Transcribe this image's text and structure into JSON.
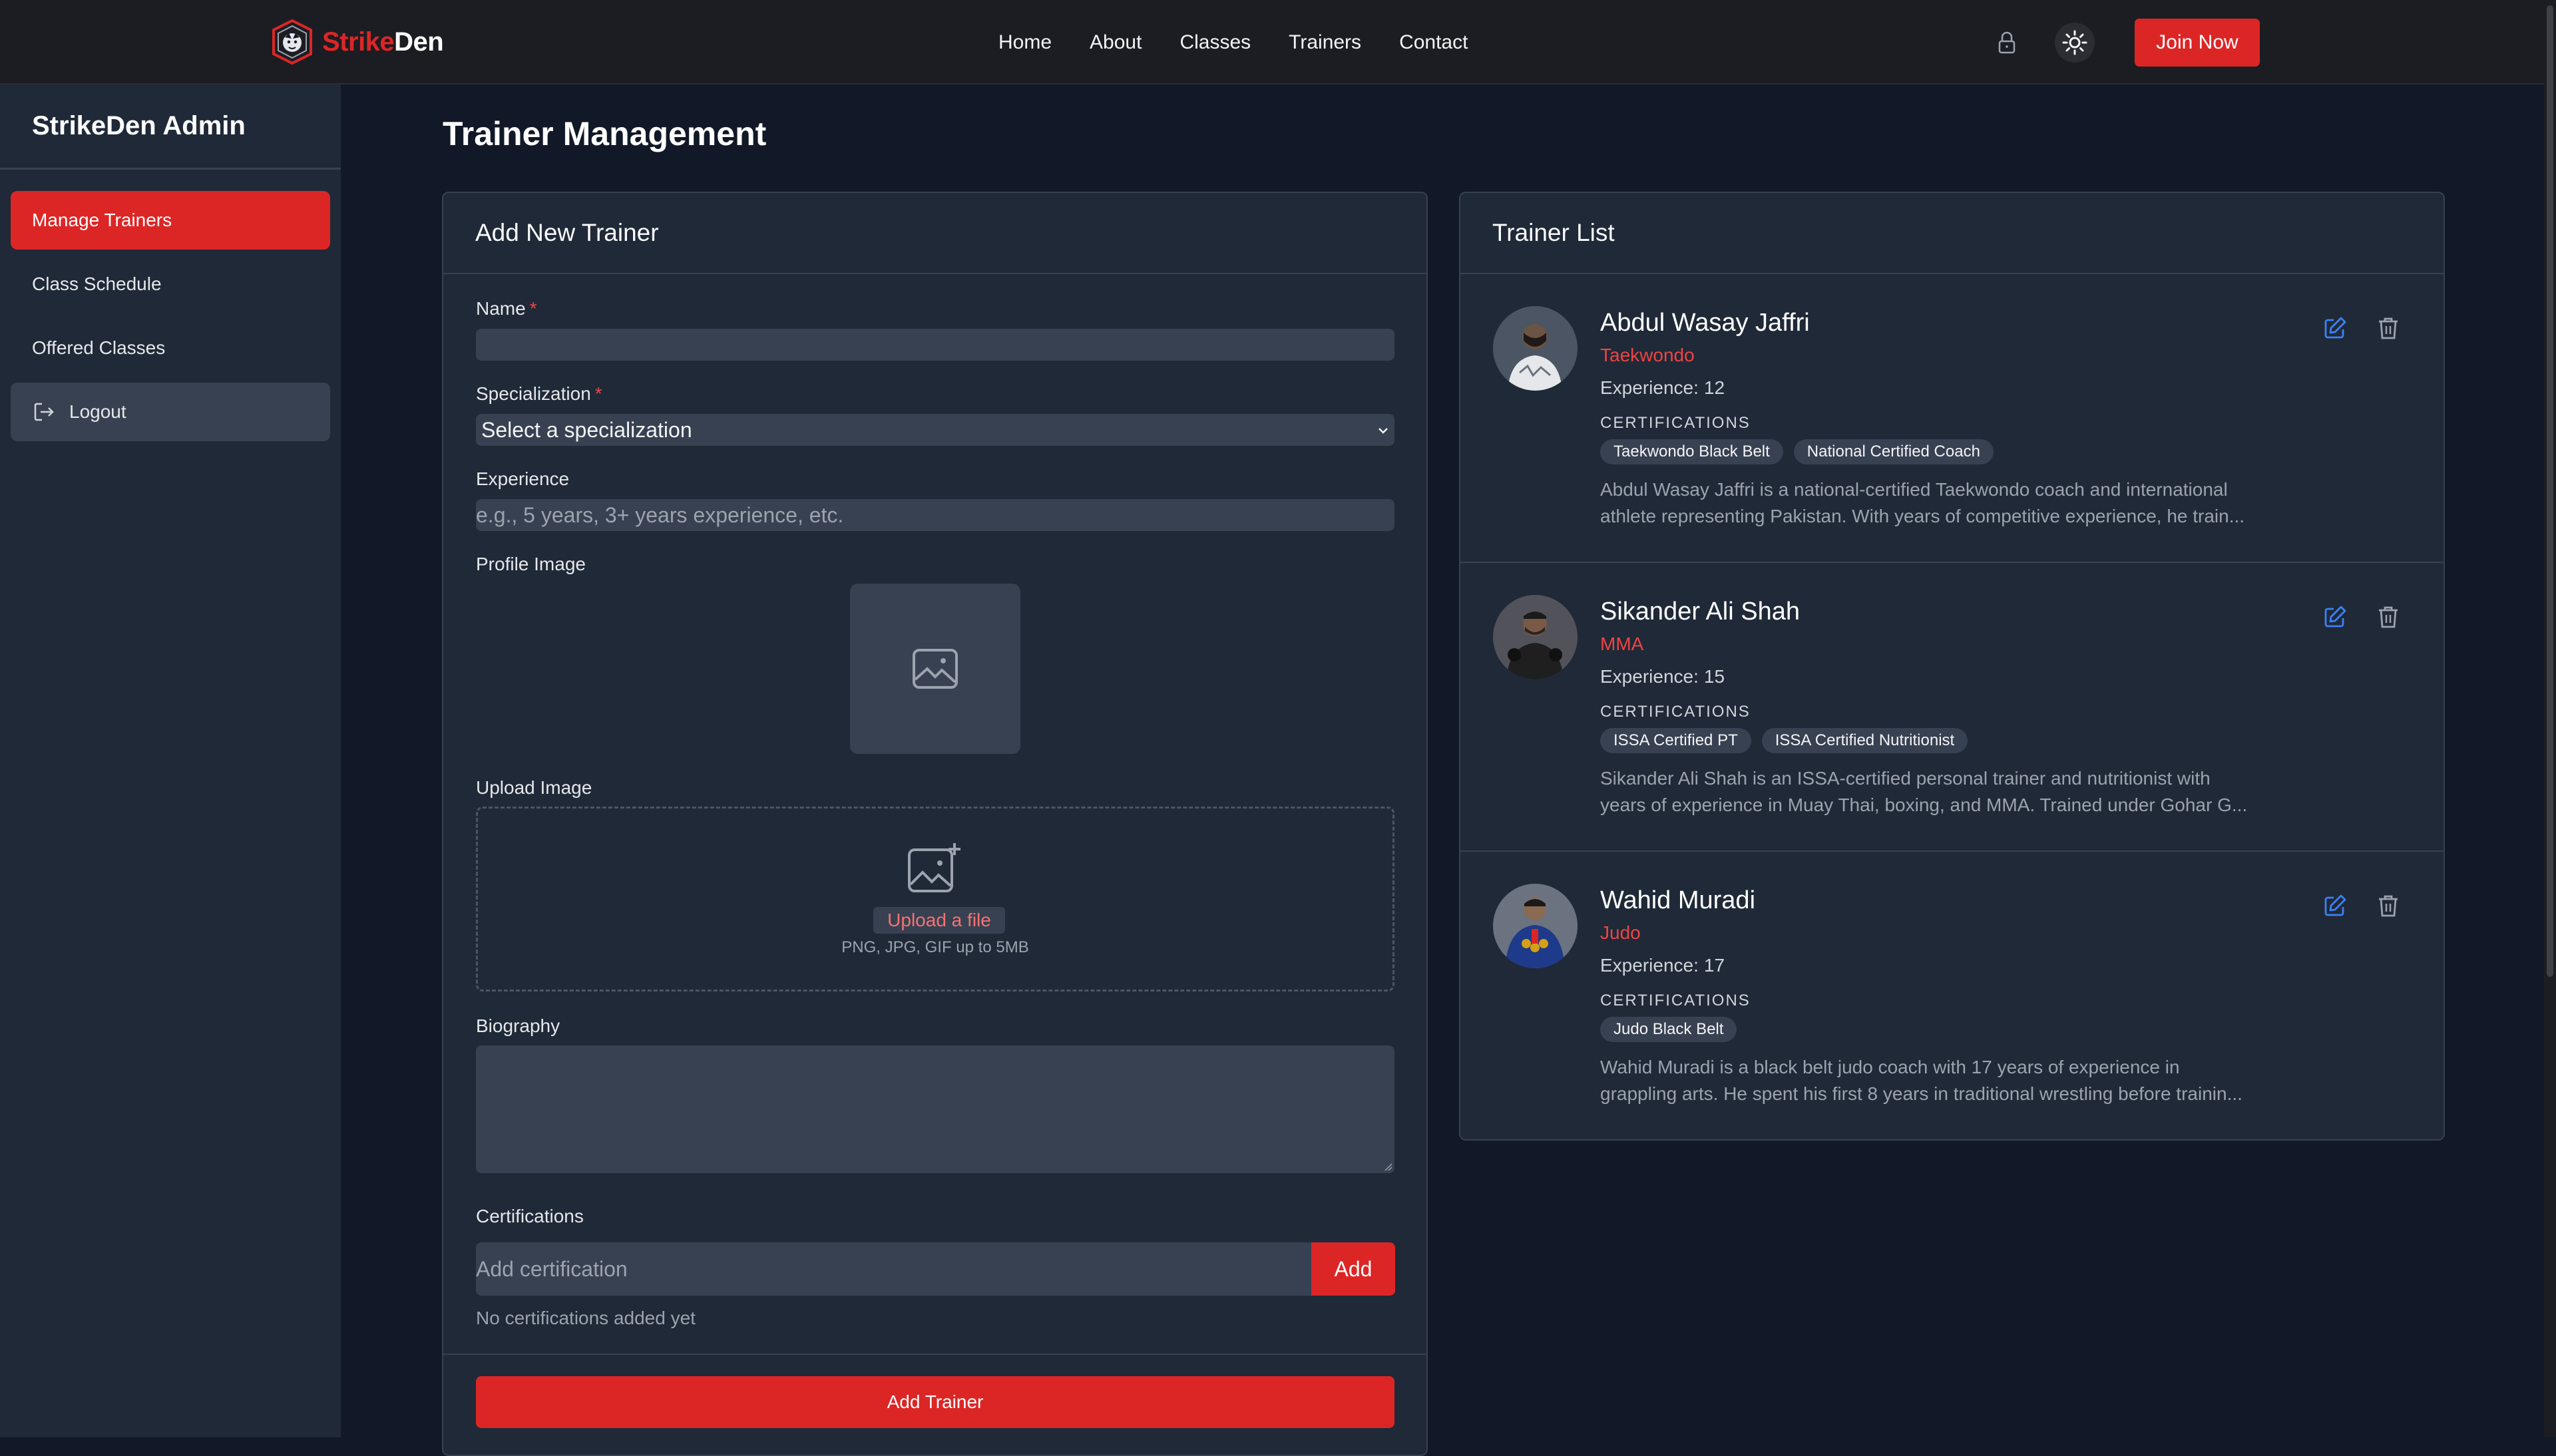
{
  "brand": {
    "name_part1": "Strike",
    "name_part2": "Den",
    "colors": {
      "accent": "#dc2626",
      "background": "#111827",
      "panel": "#1f2937",
      "input": "#374151"
    }
  },
  "nav": {
    "links": [
      "Home",
      "About",
      "Classes",
      "Trainers",
      "Contact"
    ],
    "join_label": "Join Now",
    "icons": [
      "lock-icon",
      "sun-icon"
    ]
  },
  "sidebar": {
    "title": "StrikeDen Admin",
    "items": [
      {
        "label": "Manage Trainers",
        "active": true
      },
      {
        "label": "Class Schedule",
        "active": false
      },
      {
        "label": "Offered Classes",
        "active": false
      },
      {
        "label": "Logout",
        "active": false,
        "icon": "logout-icon"
      }
    ]
  },
  "page": {
    "title": "Trainer Management"
  },
  "form": {
    "title": "Add New Trainer",
    "name_label": "Name",
    "required_mark": "*",
    "name_value": "",
    "specialization_label": "Specialization",
    "specialization_value": "Select a specialization",
    "experience_label": "Experience",
    "experience_placeholder": "e.g., 5 years, 3+ years experience, etc.",
    "profile_image_label": "Profile Image",
    "upload_label": "Upload Image",
    "upload_link": "Upload a file",
    "upload_hint": "PNG, JPG, GIF up to 5MB",
    "biography_label": "Biography",
    "certifications_label": "Certifications",
    "certification_placeholder": "Add certification",
    "add_label": "Add",
    "no_certifications": "No certifications added yet",
    "submit_label": "Add Trainer"
  },
  "trainer_list": {
    "title": "Trainer List",
    "experience_label": "Experience:",
    "certifications_label": "CERTIFICATIONS",
    "trainers": [
      {
        "name": "Abdul Wasay Jaffri",
        "specialization": "Taekwondo",
        "experience": "12",
        "certifications": [
          "Taekwondo Black Belt",
          "National Certified Coach"
        ],
        "bio_line1": "Abdul Wasay Jaffri is a national-certified Taekwondo coach and international",
        "bio_line2": "athlete representing Pakistan. With years of competitive experience, he train..."
      },
      {
        "name": "Sikander Ali Shah",
        "specialization": "MMA",
        "experience": "15",
        "certifications": [
          "ISSA Certified PT",
          "ISSA Certified Nutritionist"
        ],
        "bio_line1": "Sikander Ali Shah is an ISSA-certified personal trainer and nutritionist with",
        "bio_line2": "years of experience in Muay Thai, boxing, and MMA. Trained under Gohar G..."
      },
      {
        "name": "Wahid Muradi",
        "specialization": "Judo",
        "experience": "17",
        "certifications": [
          "Judo Black Belt"
        ],
        "bio_line1": "Wahid Muradi is a black belt judo coach with 17 years of experience in",
        "bio_line2": "grappling arts. He spent his first 8 years in traditional wrestling before trainin..."
      }
    ]
  }
}
